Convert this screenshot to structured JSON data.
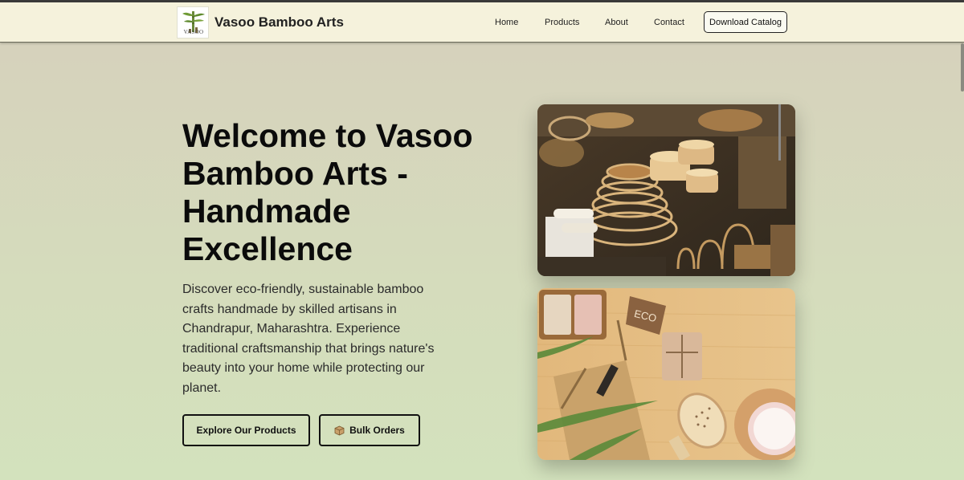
{
  "header": {
    "logo_text": "VASOO",
    "brand": "Vasoo Bamboo Arts",
    "nav": [
      "Home",
      "Products",
      "About",
      "Contact"
    ],
    "catalog_button": "Download Catalog"
  },
  "hero": {
    "title": "Welcome to Vasoo Bamboo Arts - Handmade Excellence",
    "description": "Discover eco-friendly, sustainable bamboo crafts handmade by skilled artisans in Chandrapur, Maharashtra. Experience traditional craftsmanship that brings nature's beauty into your home while protecting our planet.",
    "primary_button": "Explore Our Products",
    "secondary_button": "Bulk Orders",
    "secondary_icon": "package-icon"
  },
  "images": {
    "top_tag_text": "",
    "bottom_tag_text": "ECO"
  },
  "colors": {
    "header_bg": "#f5f2dc",
    "text": "#0b0b0b",
    "accent": "#111111"
  }
}
